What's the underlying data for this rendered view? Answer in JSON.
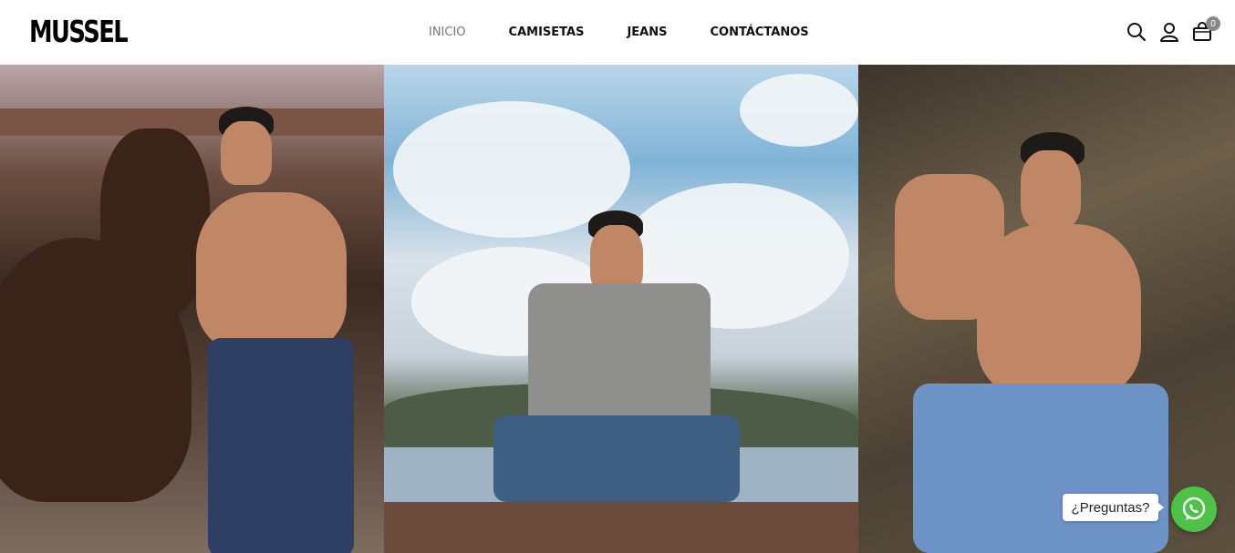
{
  "brand": {
    "logo_text": "MUSSEL"
  },
  "nav": {
    "items": [
      {
        "label": "INICIO",
        "active": true
      },
      {
        "label": "CAMISETAS",
        "active": false
      },
      {
        "label": "JEANS",
        "active": false
      },
      {
        "label": "CONTÁCTANOS",
        "active": false
      }
    ]
  },
  "header_icons": {
    "search": "search-icon",
    "account": "user-icon",
    "cart": "cart-icon",
    "cart_count": "0"
  },
  "hero": {
    "panels": [
      {
        "description_icon": "photo"
      },
      {
        "description_icon": "photo"
      },
      {
        "description_icon": "photo"
      }
    ]
  },
  "whatsapp": {
    "bubble_text": "¿Preguntas?",
    "color": "#4dc247"
  }
}
